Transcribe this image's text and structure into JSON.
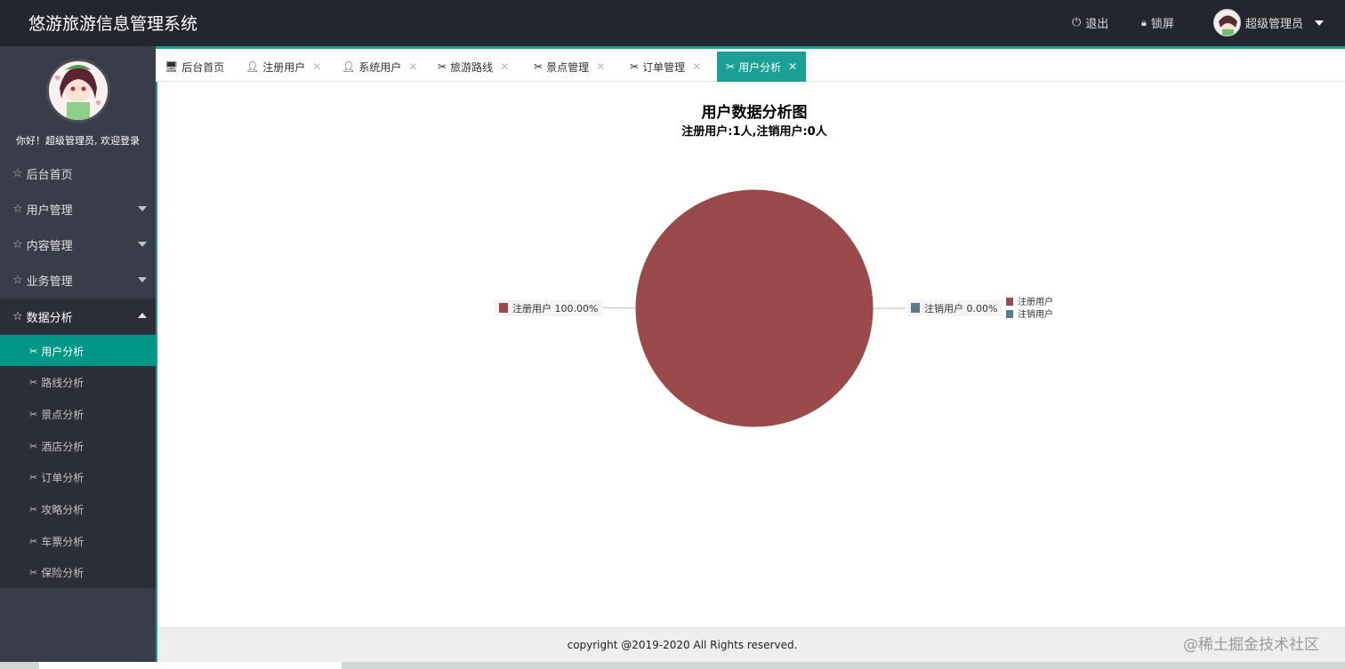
{
  "app": {
    "title": "悠游旅游信息管理系统"
  },
  "header": {
    "logout_label": "退出",
    "lock_label": "锁屏",
    "user_label": "超级管理员"
  },
  "sidebar": {
    "welcome": "你好！超级管理员, 欢迎登录",
    "menu": [
      {
        "label": "后台首页"
      },
      {
        "label": "用户管理"
      },
      {
        "label": "内容管理"
      },
      {
        "label": "业务管理"
      },
      {
        "label": "数据分析"
      }
    ],
    "submenu": [
      {
        "label": "用户分析"
      },
      {
        "label": "路线分析"
      },
      {
        "label": "景点分析"
      },
      {
        "label": "酒店分析"
      },
      {
        "label": "订单分析"
      },
      {
        "label": "攻略分析"
      },
      {
        "label": "车票分析"
      },
      {
        "label": "保险分析"
      }
    ]
  },
  "tabs": [
    {
      "label": "后台首页"
    },
    {
      "label": "注册用户"
    },
    {
      "label": "系统用户"
    },
    {
      "label": "旅游路线"
    },
    {
      "label": "景点管理"
    },
    {
      "label": "订单管理"
    },
    {
      "label": "用户分析"
    }
  ],
  "colors": {
    "accent": "#009688",
    "header": "#23262e",
    "sidebar": "#393d49"
  },
  "chart_data": {
    "type": "pie",
    "title": "用户数据分析图",
    "subtitle": "注册用户:1人,注销用户:0人",
    "slices": [
      {
        "name": "注册用户",
        "value": 1,
        "percent": "100.00%",
        "color": "#9b4a4c"
      },
      {
        "name": "注销用户",
        "value": 0,
        "percent": "0.00%",
        "color": "#5b7a90"
      }
    ],
    "legend": [
      "注册用户",
      "注销用户"
    ],
    "legend_position": "right"
  },
  "footer": {
    "text": "copyright @2019-2020 All Rights reserved."
  },
  "watermark": "@稀土掘金技术社区"
}
